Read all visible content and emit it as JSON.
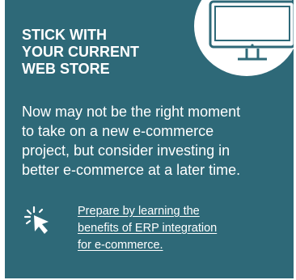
{
  "card": {
    "heading": "STICK WITH\nYOUR CURRENT\nWEB STORE",
    "body": "Now may not be the right moment\nto take on a new e-commerce\nproject, but consider investing in\nbetter e-commerce at a later time.",
    "link_text": "Prepare by learning the \nbenefits of ERP integration \nfor e-commerce.",
    "monitor_icon": "desktop-monitor-icon",
    "pointer_icon": "cursor-click-icon"
  },
  "colors": {
    "background": "#2e6978",
    "text": "#ffffff",
    "badge": "#ffffff"
  }
}
